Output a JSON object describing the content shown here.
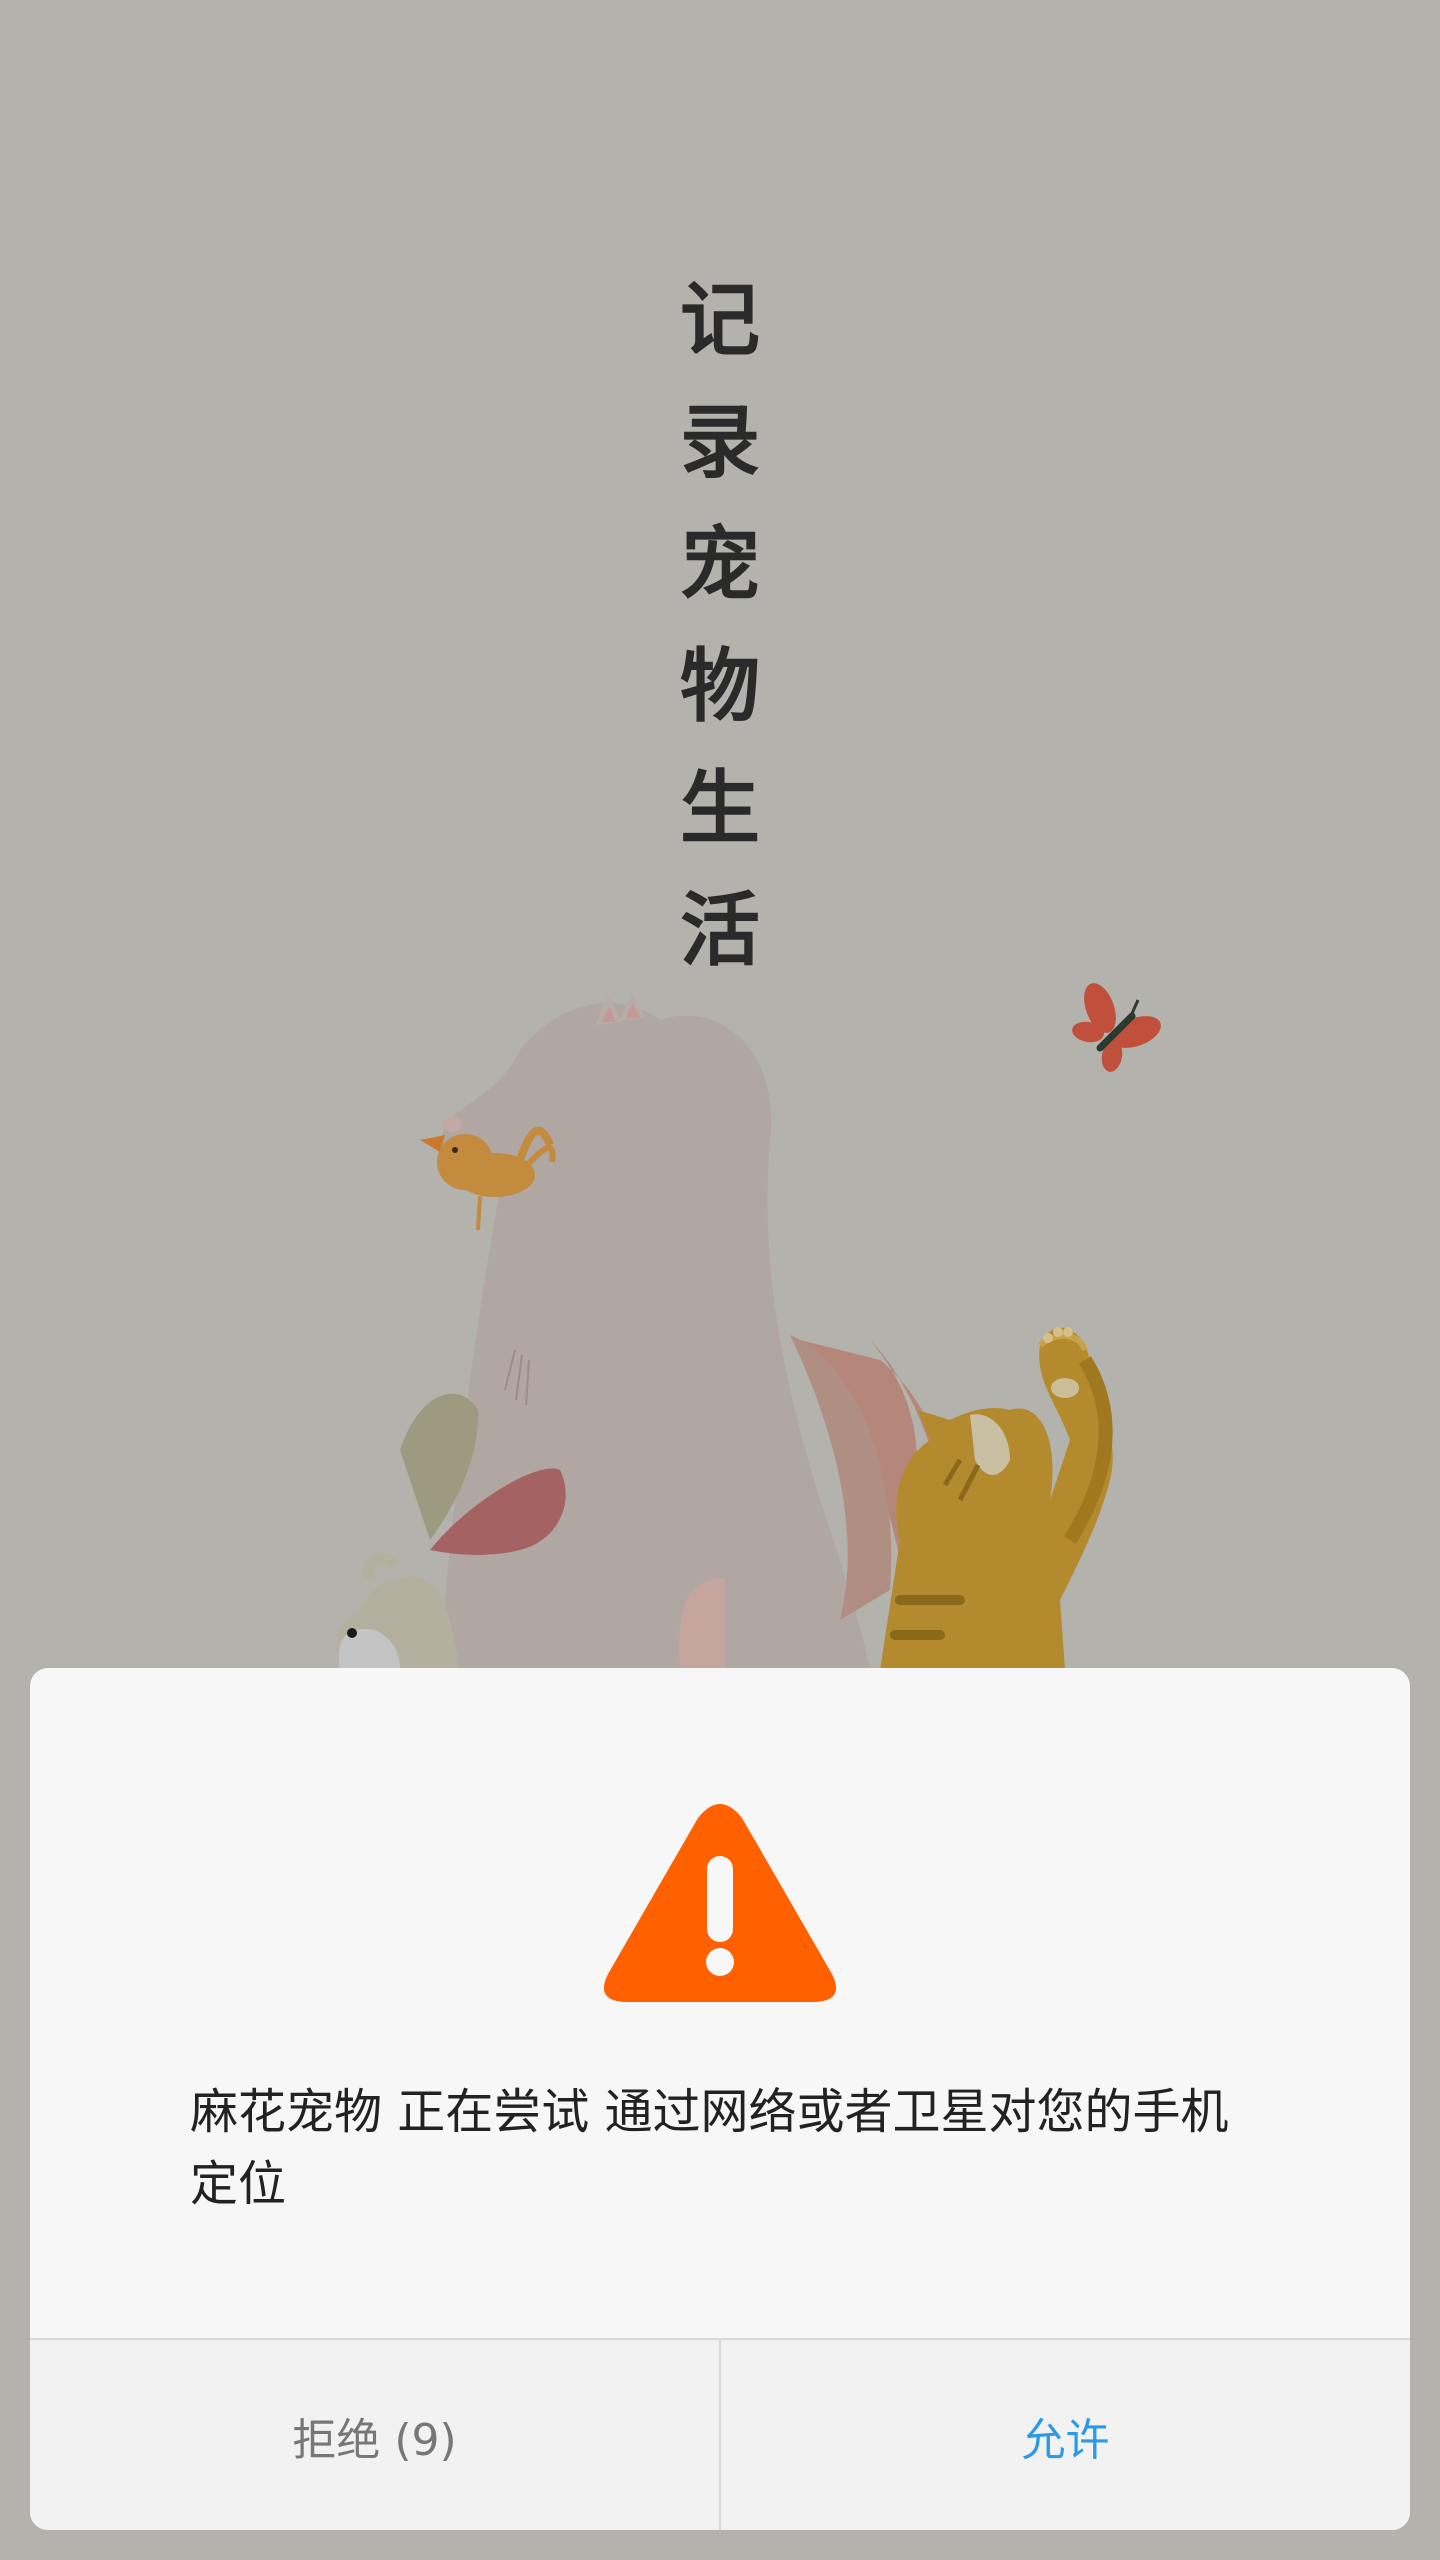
{
  "splash": {
    "tagline_chars": [
      "记",
      "录",
      "宠",
      "物",
      "生",
      "活"
    ]
  },
  "permission_dialog": {
    "message": "麻花宠物 正在尝试 通过网络或者卫星对您的手机定位",
    "icon": "warning-icon",
    "deny_label": "拒绝 (9)",
    "allow_label": "允许"
  },
  "colors": {
    "background": "#b3b2ad",
    "dialog_background": "#f7f7f7",
    "warning_orange": "#ff6100",
    "allow_blue": "#2a9ae6",
    "deny_gray": "#777777"
  }
}
